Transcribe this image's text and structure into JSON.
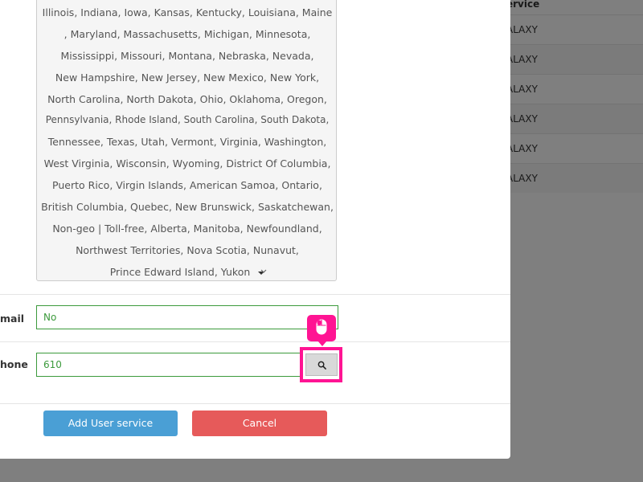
{
  "background_table": {
    "header": "ervice",
    "rows": [
      "ALAXY",
      "ALAXY",
      "ALAXY",
      "ALAXY",
      "ALAXY",
      "ALAXY"
    ]
  },
  "state_list": {
    "lines": [
      "Illinois,  Indiana,  Iowa,  Kansas,  Kentucky,  Louisiana,  Maine",
      ",  Maryland,  Massachusetts,  Michigan,  Minnesota,",
      "Mississippi,  Missouri,  Montana,  Nebraska,  Nevada,",
      "New Hampshire,  New Jersey,  New Mexico,  New York,",
      "North Carolina,  North Dakota,  Ohio,  Oklahoma,  Oregon,",
      "Pennsylvania,  Rhode Island,  South Carolina,  South Dakota,",
      "Tennessee,  Texas,  Utah,  Vermont,  Virginia,  Washington,",
      "West Virginia,  Wisconsin,  Wyoming,  District Of Columbia,",
      "Puerto Rico,  Virgin Islands,  American Samoa,  Ontario,",
      "British Columbia,  Quebec,  New Brunswick,  Saskatchewan,",
      "Non-geo | Toll-free,  Alberta,  Manitoba,  Newfoundland,",
      "Northwest Territories,  Nova Scotia,  Nunavut,",
      "Prince Edward Island,  Yukon"
    ]
  },
  "fields": {
    "email": {
      "label": "mail",
      "value": "No"
    },
    "phone": {
      "label": "hone",
      "value": "610"
    }
  },
  "buttons": {
    "add_label": "Add User service",
    "cancel_label": "Cancel"
  },
  "icons": {
    "search": "search-icon",
    "mouse": "mouse-icon",
    "caret": "caret-down-icon",
    "chevron": "chevron-down-icon"
  },
  "colors": {
    "primary": "#4a9fd5",
    "danger": "#e65a5a",
    "valid": "#3c9a3c",
    "highlight": "#ff1493"
  }
}
